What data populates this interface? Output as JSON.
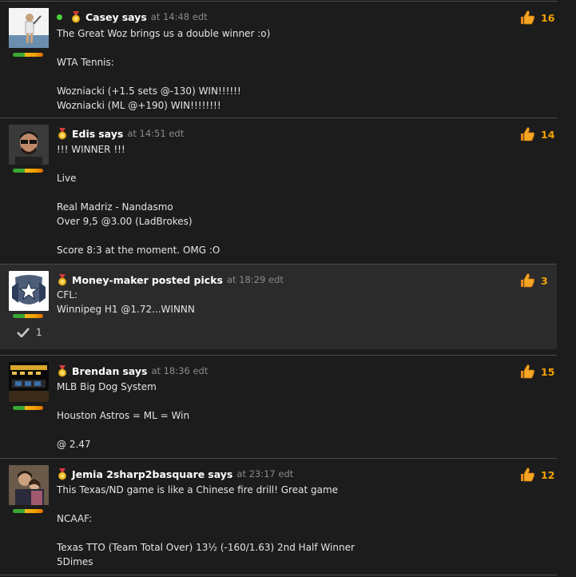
{
  "posts": [
    {
      "name": "Casey",
      "verb": "says",
      "time": "at 14:48 edt",
      "likes": "16",
      "lines": [
        "The Great Woz brings us a double winner :o)",
        "",
        "WTA Tennis:",
        "",
        "Wozniacki (+1.5 sets @-130) WIN!!!!!!",
        "Wozniacki (ML @+190) WIN!!!!!!!!"
      ]
    },
    {
      "name": "Edis",
      "verb": "says",
      "time": "at 14:51 edt",
      "likes": "14",
      "lines": [
        "!!! WINNER !!!",
        "",
        "Live",
        "",
        "Real Madriz - Nandasmo",
        "Over 9,5 @3.00 (LadBrokes)",
        "",
        "Score 8:3 at the moment. OMG :O"
      ]
    },
    {
      "name": "Money-maker",
      "verb": "posted picks",
      "time": "at 18:29 edt",
      "likes": "3",
      "check_count": "1",
      "lines": [
        "CFL:",
        "Winnipeg H1 @1.72...WINNN"
      ]
    },
    {
      "name": "Brendan",
      "verb": "says",
      "time": "at 18:36 edt",
      "likes": "15",
      "lines": [
        "MLB Big Dog System",
        "",
        "Houston Astros = ML = Win",
        "",
        "@ 2.47"
      ]
    },
    {
      "name": "Jemia 2sharp2basquare",
      "verb": "says",
      "time": "at 23:17 edt",
      "likes": "12",
      "lines": [
        "This Texas/ND game is like a Chinese fire drill! Great game",
        "",
        "NCAAF:",
        "",
        "Texas TTO (Team Total Over) 13½ (-160/1.63) 2nd Half Winner",
        "5Dimes"
      ]
    }
  ],
  "icons": {
    "medal": "medal-icon",
    "thumb": "thumbs-up-icon",
    "online": "online-status-icon",
    "check": "checkmark-icon"
  },
  "colors": {
    "likes": "#f5a200",
    "online": "#4bd23a",
    "background": "#1c1c1c",
    "highlight": "#2b2b2b"
  }
}
